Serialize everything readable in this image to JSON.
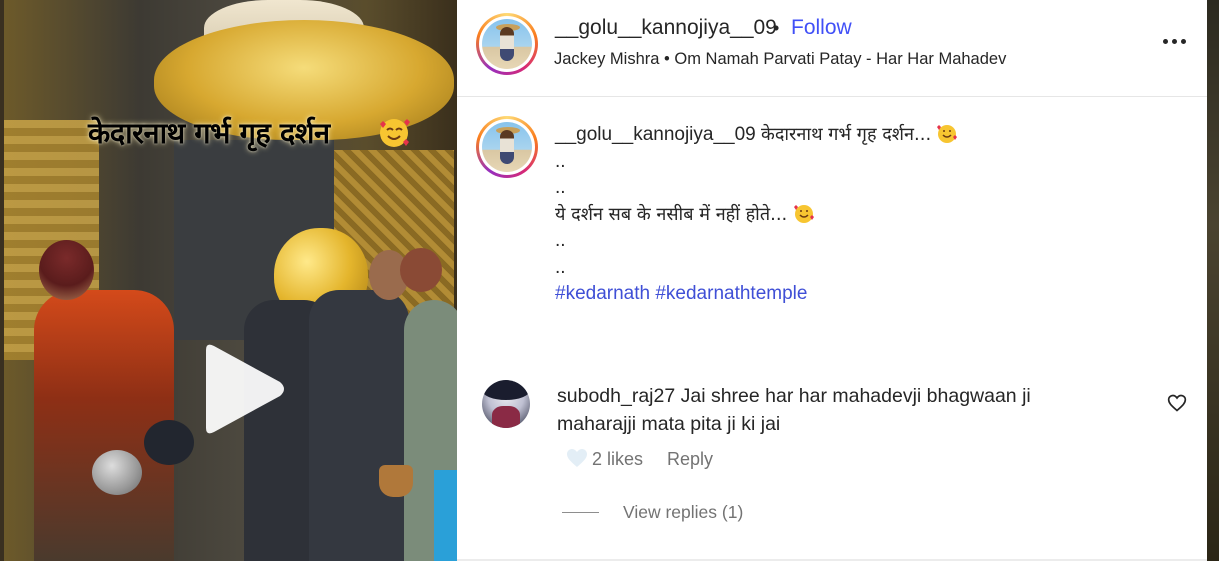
{
  "video": {
    "overlay_text": "केदारनाथ गर्भ गृह दर्शन",
    "overlay_emoji": "smiling-face-with-hearts-icon",
    "play_icon": "play-icon"
  },
  "header": {
    "username": "__golu__kannojiya__09",
    "separator": "•",
    "follow_label": "Follow",
    "audio_info": "Jackey Mishra • Om Namah Parvati Patay - Har Har Mahadev",
    "more_icon": "more-options-icon"
  },
  "caption": {
    "username": "__golu__kannojiya__09",
    "line1_text": "केदारनाथ गर्भ गृह दर्शन...",
    "line2": "..",
    "line3": "..",
    "line4_text": "ये दर्शन सब के नसीब में नहीं होते...",
    "line5": "..",
    "line6": "..",
    "hashtags": [
      "#kedarnath",
      "#kedarnathtemple"
    ]
  },
  "comment": {
    "username": "subodh_raj27",
    "text_line1": "Jai shree har har mahadevji bhagwaan ji",
    "text_line2": "maharajji mata pita ji ki jai",
    "likes": "2 likes",
    "reply_label": "Reply",
    "view_replies": "View replies (1)"
  },
  "colors": {
    "link_blue": "#4150f7",
    "hashtag_blue": "#3f4fd6",
    "meta_gray": "#737373",
    "text_dark": "#262626"
  }
}
